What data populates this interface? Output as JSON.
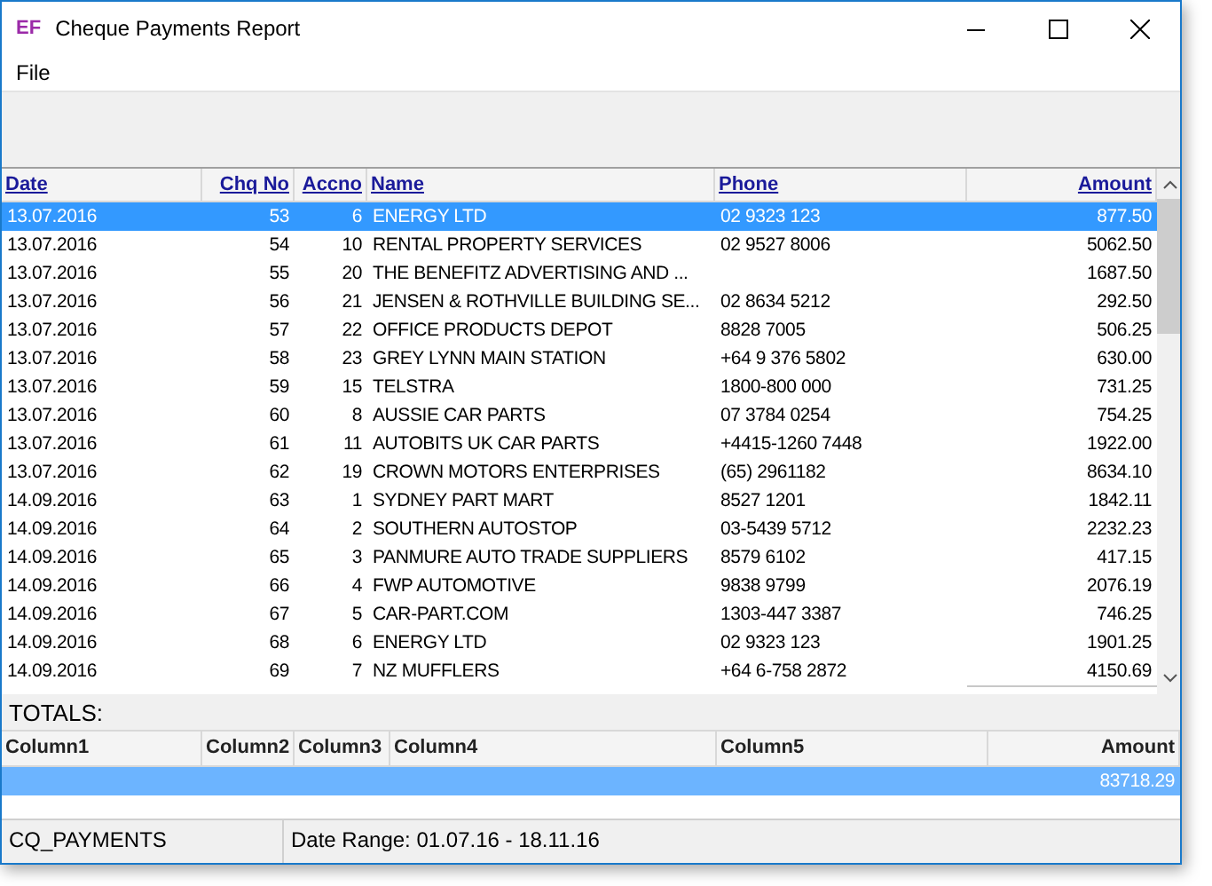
{
  "window": {
    "logo": "EF",
    "title": "Cheque Payments Report"
  },
  "menu": [
    "File"
  ],
  "table": {
    "columns": [
      "Date",
      "Chq No",
      "Accno",
      "Name",
      "Phone",
      "Amount"
    ],
    "rows": [
      {
        "selected": true,
        "cells": [
          "13.07.2016",
          "53",
          "6",
          "ENERGY LTD",
          "02 9323 123",
          "877.50"
        ]
      },
      {
        "selected": false,
        "cells": [
          "13.07.2016",
          "54",
          "10",
          "RENTAL PROPERTY SERVICES",
          "02 9527 8006",
          "5062.50"
        ]
      },
      {
        "selected": false,
        "cells": [
          "13.07.2016",
          "55",
          "20",
          "THE BENEFITZ ADVERTISING AND ...",
          "",
          "1687.50"
        ]
      },
      {
        "selected": false,
        "cells": [
          "13.07.2016",
          "56",
          "21",
          "JENSEN & ROTHVILLE BUILDING SE...",
          "02 8634 5212",
          "292.50"
        ]
      },
      {
        "selected": false,
        "cells": [
          "13.07.2016",
          "57",
          "22",
          "OFFICE PRODUCTS DEPOT",
          "8828 7005",
          "506.25"
        ]
      },
      {
        "selected": false,
        "cells": [
          "13.07.2016",
          "58",
          "23",
          "GREY LYNN MAIN STATION",
          "+64 9 376 5802",
          "630.00"
        ]
      },
      {
        "selected": false,
        "cells": [
          "13.07.2016",
          "59",
          "15",
          "TELSTRA",
          "1800-800 000",
          "731.25"
        ]
      },
      {
        "selected": false,
        "cells": [
          "13.07.2016",
          "60",
          "8",
          "AUSSIE CAR PARTS",
          "07 3784 0254",
          "754.25"
        ]
      },
      {
        "selected": false,
        "cells": [
          "13.07.2016",
          "61",
          "11",
          "AUTOBITS UK CAR PARTS",
          "+4415-1260 7448",
          "1922.00"
        ]
      },
      {
        "selected": false,
        "cells": [
          "13.07.2016",
          "62",
          "19",
          "CROWN MOTORS ENTERPRISES",
          "(65) 2961182",
          "8634.10"
        ]
      },
      {
        "selected": false,
        "cells": [
          "14.09.2016",
          "63",
          "1",
          "SYDNEY PART MART",
          "8527 1201",
          "1842.11"
        ]
      },
      {
        "selected": false,
        "cells": [
          "14.09.2016",
          "64",
          "2",
          "SOUTHERN AUTOSTOP",
          "03-5439 5712",
          "2232.23"
        ]
      },
      {
        "selected": false,
        "cells": [
          "14.09.2016",
          "65",
          "3",
          "PANMURE AUTO TRADE SUPPLIERS",
          "8579 6102",
          "417.15"
        ]
      },
      {
        "selected": false,
        "cells": [
          "14.09.2016",
          "66",
          "4",
          "FWP AUTOMOTIVE",
          "9838 9799",
          "2076.19"
        ]
      },
      {
        "selected": false,
        "cells": [
          "14.09.2016",
          "67",
          "5",
          "CAR-PART.COM",
          "1303-447 3387",
          "746.25"
        ]
      },
      {
        "selected": false,
        "cells": [
          "14.09.2016",
          "68",
          "6",
          "ENERGY LTD",
          "02 9323 123",
          "1901.25"
        ]
      },
      {
        "selected": false,
        "cells": [
          "14.09.2016",
          "69",
          "7",
          "NZ MUFFLERS",
          "+64 6-758 2872",
          "4150.69"
        ]
      }
    ]
  },
  "totals": {
    "label": "TOTALS:",
    "columns": [
      "Column1",
      "Column2",
      "Column3",
      "Column4",
      "Column5",
      "Amount"
    ],
    "rows": [
      {
        "selected": true,
        "cells": [
          "",
          "",
          "",
          "",
          "",
          "83718.29"
        ]
      }
    ]
  },
  "status_bar": [
    "CQ_PAYMENTS",
    "Date Range: 01.07.16 - 18.11.16"
  ]
}
